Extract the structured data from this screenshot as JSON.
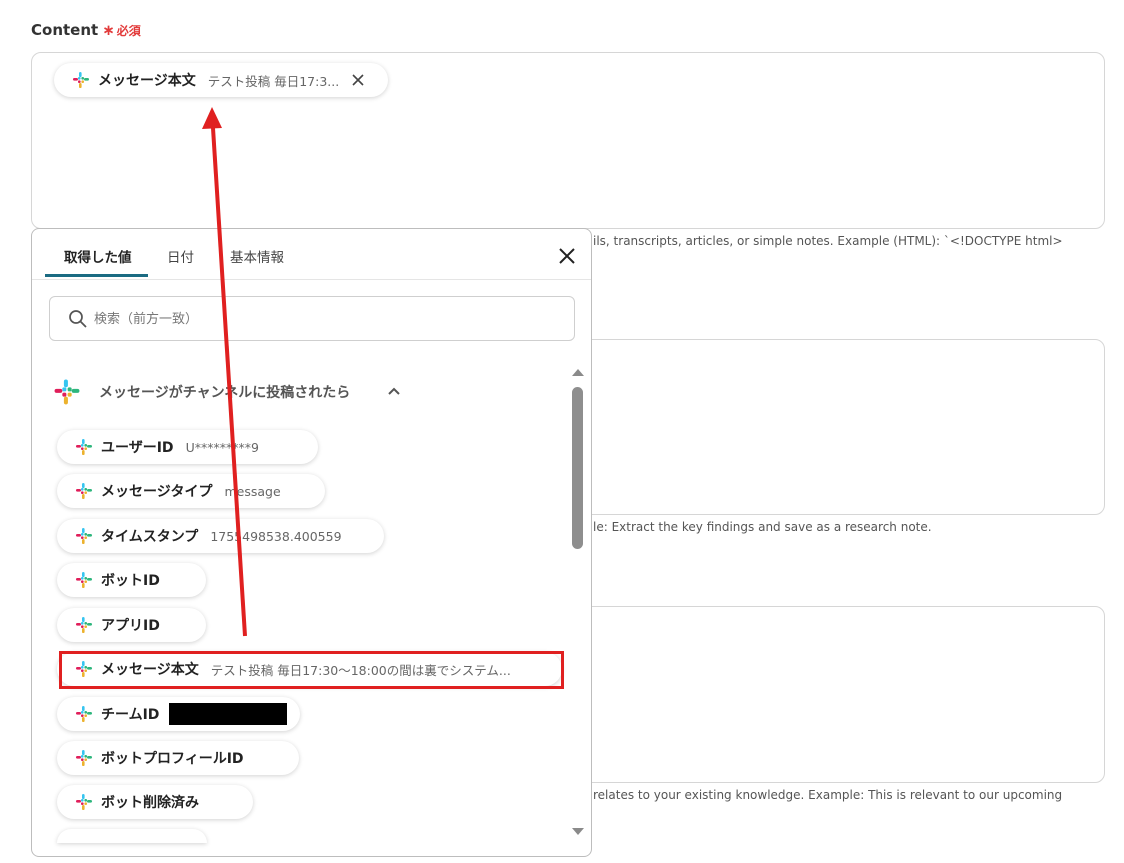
{
  "field": {
    "label": "Content",
    "required_star": "∗",
    "required_text": "必須"
  },
  "content_chip": {
    "name": "メッセージ本文",
    "value": "テスト投稿 毎日17:3..."
  },
  "hints": {
    "content": "ils, transcripts, articles, or simple notes. Example (HTML): `<!DOCTYPE html>",
    "second": "le: Extract the key findings and save as a research note.",
    "third": "relates to your existing knowledge. Example: This is relevant to our upcoming"
  },
  "popup": {
    "tabs": [
      "取得した値",
      "日付",
      "基本情報"
    ],
    "active_tab": "取得した値",
    "search_placeholder": "検索（前方一致）",
    "group_title": "メッセージがチャンネルに投稿されたら",
    "items": [
      {
        "name": "ユーザーID",
        "value": "U*********9"
      },
      {
        "name": "メッセージタイプ",
        "value": "message"
      },
      {
        "name": "タイムスタンプ",
        "value": "1755498538.400559"
      },
      {
        "name": "ボットID",
        "value": ""
      },
      {
        "name": "アプリID",
        "value": ""
      },
      {
        "name": "メッセージ本文",
        "value": "テスト投稿 毎日17:30〜18:00の間は裏でシステム...",
        "highlighted": true
      },
      {
        "name": "チームID",
        "value": "",
        "redacted": true
      },
      {
        "name": "ボットプロフィールID",
        "value": ""
      },
      {
        "name": "ボット削除済み",
        "value": ""
      }
    ]
  },
  "colors": {
    "required": "#e23a3a",
    "tab_underline": "#1b6b82",
    "highlight_box": "#e02020",
    "arrow": "#e02020",
    "slack_blue": "#36c5f0",
    "slack_green": "#2eb67d",
    "slack_yellow": "#ecb22e",
    "slack_red": "#e01e5a"
  },
  "icons": {
    "source": "slack-icon",
    "close": "close-icon",
    "search": "search-icon",
    "collapse": "chevron-up-icon"
  }
}
